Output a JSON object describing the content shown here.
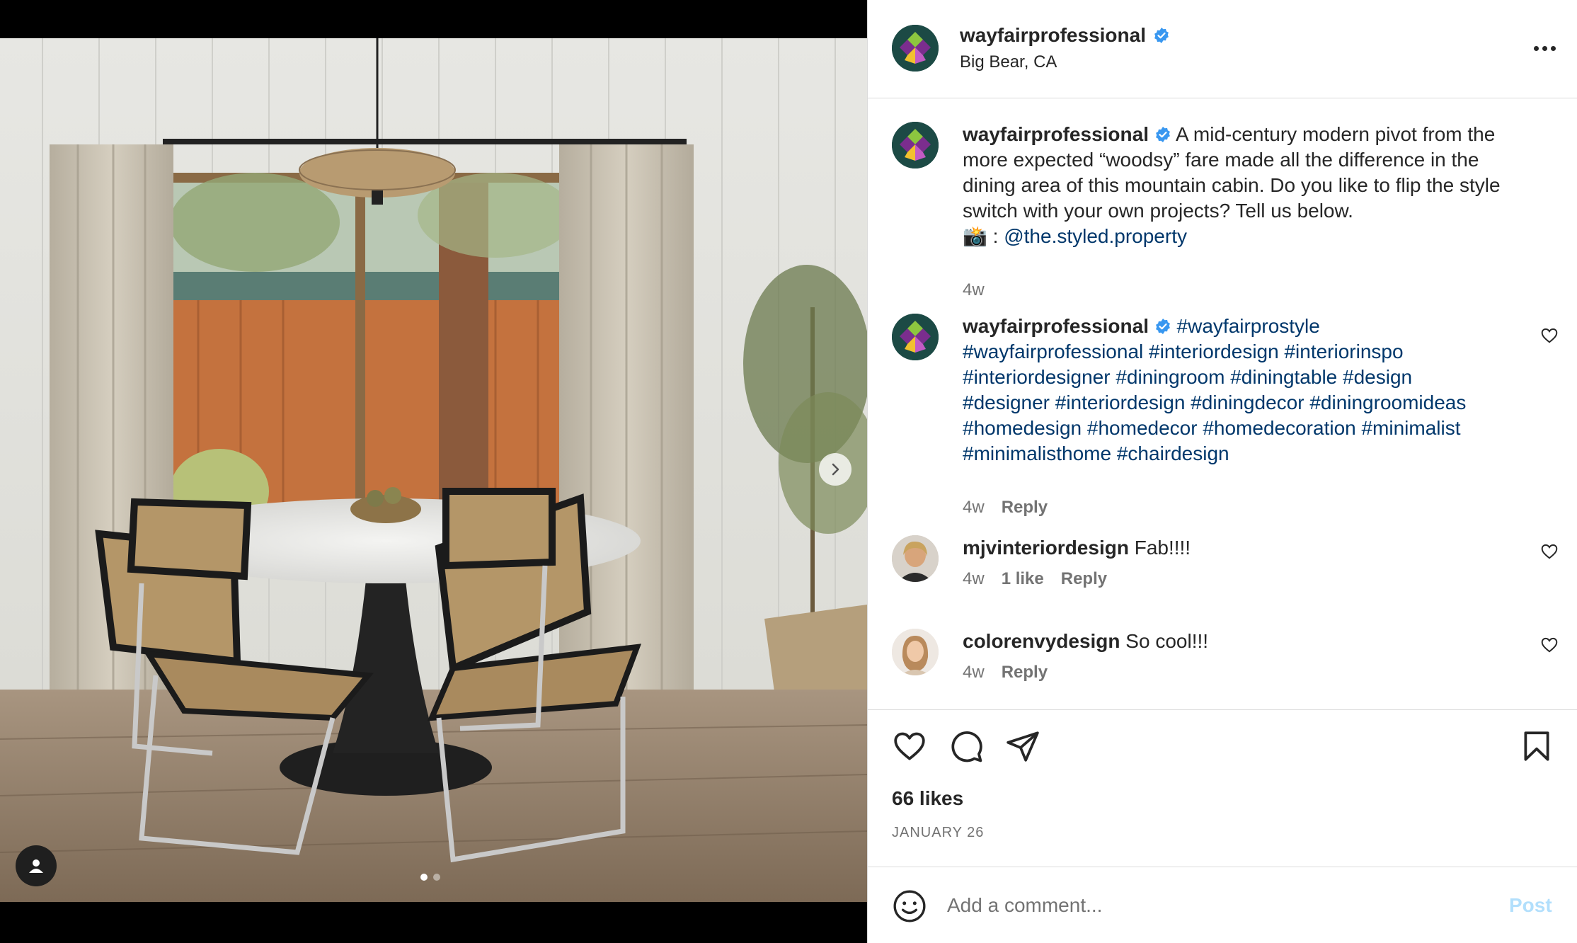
{
  "post": {
    "username": "wayfairprofessional",
    "location": "Big Bear, CA",
    "verified": true
  },
  "caption": {
    "username": "wayfairprofessional",
    "line1": "A mid-century modern pivot from the",
    "line2": "more expected “woodsy” fare made all the difference in the",
    "line3": "dining area of this mountain cabin. Do you like to flip the style",
    "line4": "switch with your own projects? Tell us below.",
    "camera_emoji": "📸",
    "credit_sep": " : ",
    "credit_handle": "@the.styled.property",
    "time": "4w"
  },
  "hashtag_comment": {
    "username": "wayfairprofessional",
    "line1": "#wayfairprostyle",
    "line2": "#wayfairprofessional #interiordesign #interiorinspo",
    "line3": "#interiordesigner #diningroom #diningtable #design",
    "line4": "#designer #interiordesign #diningdecor #diningroomideas",
    "line5": "#homedesign #homedecor #homedecoration #minimalist",
    "line6": "#minimalisthome #chairdesign",
    "time": "4w",
    "reply": "Reply"
  },
  "comments": [
    {
      "username": "mjvinteriordesign",
      "text": "Fab!!!!",
      "time": "4w",
      "likes": "1 like",
      "reply": "Reply"
    },
    {
      "username": "colorenvydesign",
      "text": "So cool!!!",
      "time": "4w",
      "reply": "Reply"
    }
  ],
  "engagement": {
    "likes": "66 likes",
    "date": "JANUARY 26"
  },
  "composer": {
    "placeholder": "Add a comment...",
    "post_label": "Post"
  },
  "carousel": {
    "total": 2,
    "current": 1
  },
  "icons": {
    "like": "heart-icon",
    "comment": "comment-icon",
    "share": "paper-plane-icon",
    "save": "bookmark-icon",
    "more": "more-options-icon",
    "next": "chevron-right-icon",
    "tag": "user-tag-icon",
    "emoji": "emoji-icon"
  },
  "colors": {
    "link": "#00376b",
    "verified": "#3897f0",
    "muted": "#737373",
    "post_disabled": "#b2dffc",
    "brand_bg": "#1c4a45"
  }
}
